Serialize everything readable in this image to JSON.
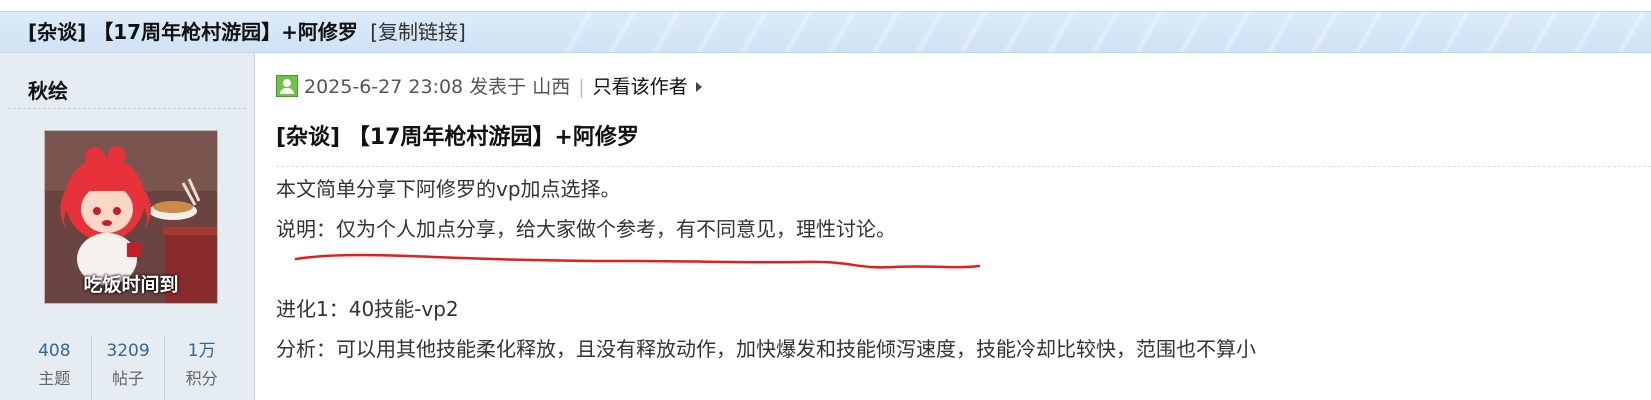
{
  "thread": {
    "title": "[杂谈] 【17周年枪村游园】+阿修罗",
    "copy_link_label": "[复制链接]"
  },
  "author": {
    "name": "秋绘",
    "avatar_caption": "吃饭时间到",
    "stats": [
      {
        "value": "408",
        "label": "主题"
      },
      {
        "value": "3209",
        "label": "帖子"
      },
      {
        "value": "1万",
        "label": "积分"
      }
    ]
  },
  "post": {
    "online_icon": "online-user-icon",
    "timestamp": "2025-6-27 23:08",
    "posted_from": "发表于 山西",
    "separator": "|",
    "only_author_label": "只看该作者",
    "arrow_icon": "triangle-right-icon",
    "title": "[杂谈] 【17周年枪村游园】+阿修罗",
    "body_lines": [
      "本文简单分享下阿修罗的vp加点选择。",
      "说明：仅为个人加点分享，给大家做个参考，有不同意见，理性讨论。",
      "",
      "进化1：40技能-vp2",
      "分析：可以用其他技能柔化释放，且没有释放动作，加快爆发和技能倾泻速度，技能冷却比较快，范围也不算小"
    ],
    "annotation_color": "#e02020"
  },
  "colors": {
    "header_bg": "#d4e6f6",
    "sidebar_bg": "#e5edf2",
    "stat_value": "#336699",
    "border": "#c2d5e3"
  }
}
